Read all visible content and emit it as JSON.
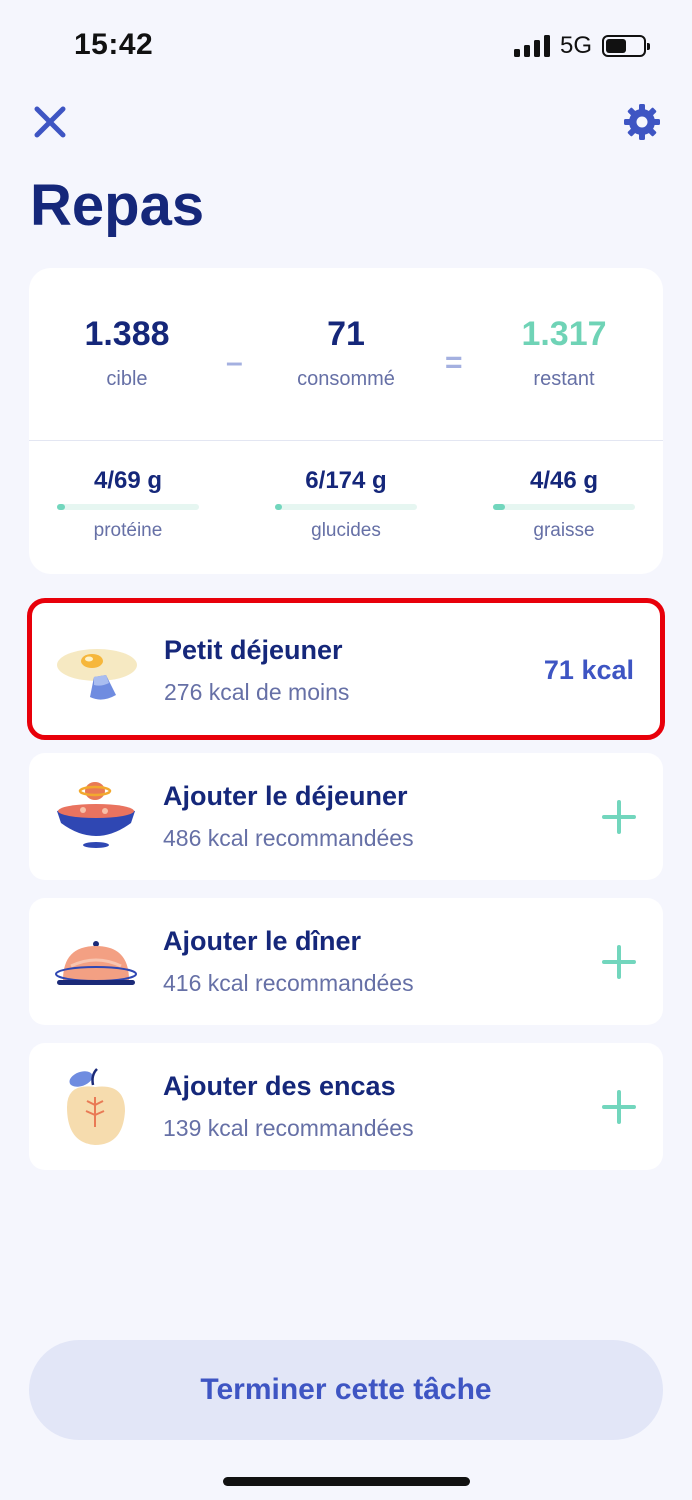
{
  "status_bar": {
    "time": "15:42",
    "network": "5G",
    "battery_level": 0.55
  },
  "nav": {
    "close_icon": "close-icon",
    "settings_icon": "gear-icon",
    "accent_color": "#3e55c3"
  },
  "page_title": "Repas",
  "summary": {
    "target_value": "1.388",
    "target_label": "cible",
    "minus": "–",
    "consumed_value": "71",
    "consumed_label": "consommé",
    "equals": "=",
    "remaining_value": "1.317",
    "remaining_label": "restant",
    "remaining_color": "#6fd3b6"
  },
  "macros": [
    {
      "value": "4/69 g",
      "label": "protéine",
      "progress": 0.058
    },
    {
      "value": "6/174 g",
      "label": "glucides",
      "progress": 0.034
    },
    {
      "value": "4/46 g",
      "label": "graisse",
      "progress": 0.087
    }
  ],
  "meals": [
    {
      "title": "Petit déjeuner",
      "subtitle": "276 kcal de moins",
      "kcal": "71 kcal",
      "icon": "fried-egg-icon",
      "highlighted": true
    },
    {
      "title": "Ajouter le déjeuner",
      "subtitle": "486 kcal recommandées",
      "icon": "soup-bowl-icon",
      "action_icon": "plus-icon"
    },
    {
      "title": "Ajouter le dîner",
      "subtitle": "416 kcal recommandées",
      "icon": "cloche-icon",
      "action_icon": "plus-icon"
    },
    {
      "title": "Ajouter des encas",
      "subtitle": "139 kcal recommandées",
      "icon": "apple-icon",
      "action_icon": "plus-icon"
    }
  ],
  "finish_button": "Terminer cette tâche"
}
